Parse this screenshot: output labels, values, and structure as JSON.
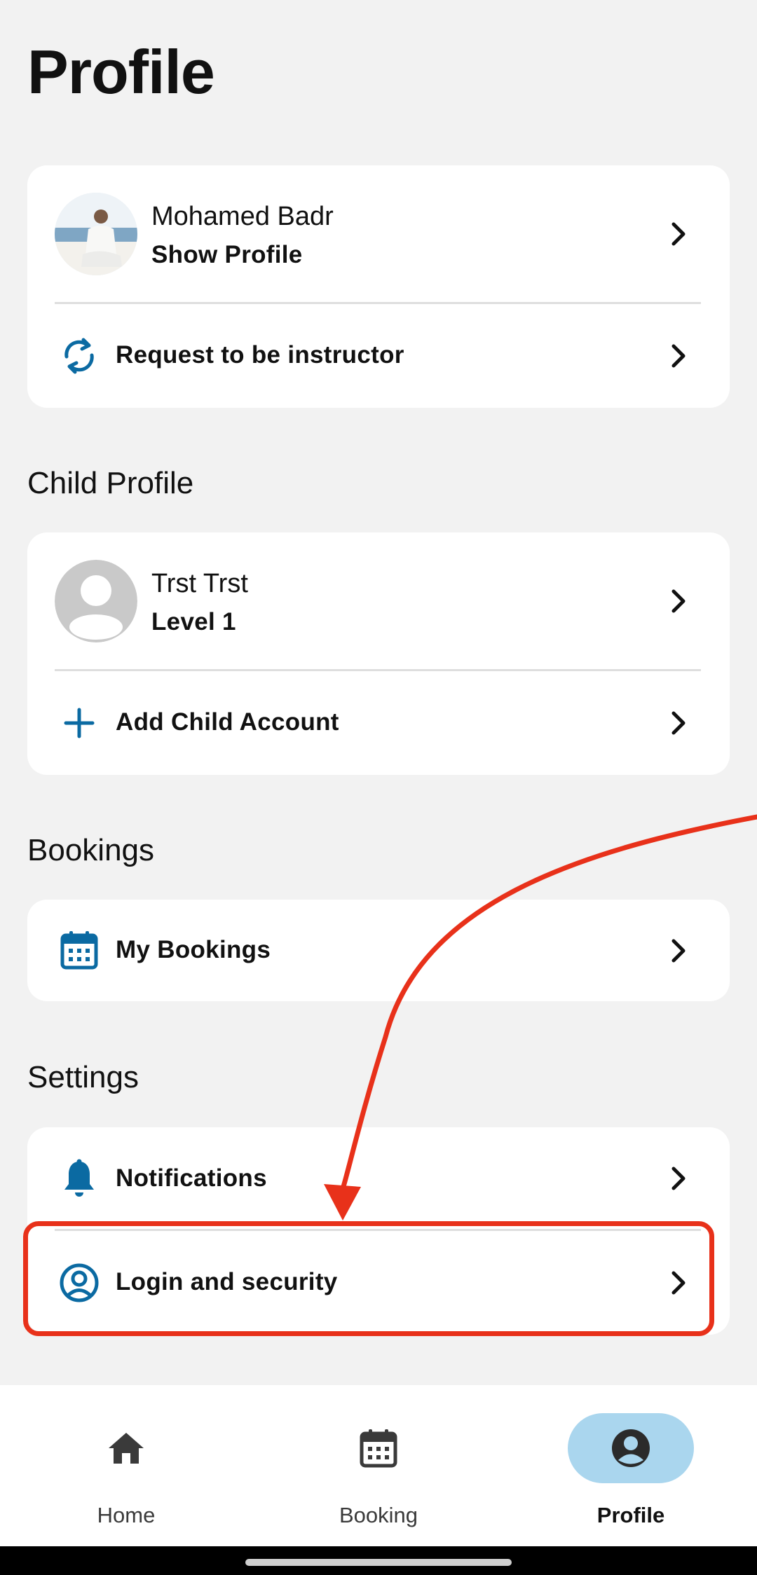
{
  "page": {
    "title": "Profile"
  },
  "profile_card": {
    "name": "Mohamed Badr",
    "subtitle": "Show Profile",
    "request_label": "Request to be instructor"
  },
  "child_section": {
    "title": "Child Profile",
    "child_name": "Trst Trst",
    "child_level": "Level 1",
    "add_label": "Add Child Account"
  },
  "bookings_section": {
    "title": "Bookings",
    "my_bookings_label": "My Bookings"
  },
  "settings_section": {
    "title": "Settings",
    "notifications_label": "Notifications",
    "login_security_label": "Login and security"
  },
  "bottom_nav": {
    "items": [
      {
        "label": "Home",
        "icon": "home-icon",
        "active": false
      },
      {
        "label": "Booking",
        "icon": "calendar-icon",
        "active": false
      },
      {
        "label": "Profile",
        "icon": "account-circle-icon",
        "active": true
      }
    ]
  },
  "colors": {
    "accent": "#0b6aa2",
    "annotation": "#e8311a",
    "active_nav": "#aad6ee",
    "background": "#f2f2f2"
  }
}
